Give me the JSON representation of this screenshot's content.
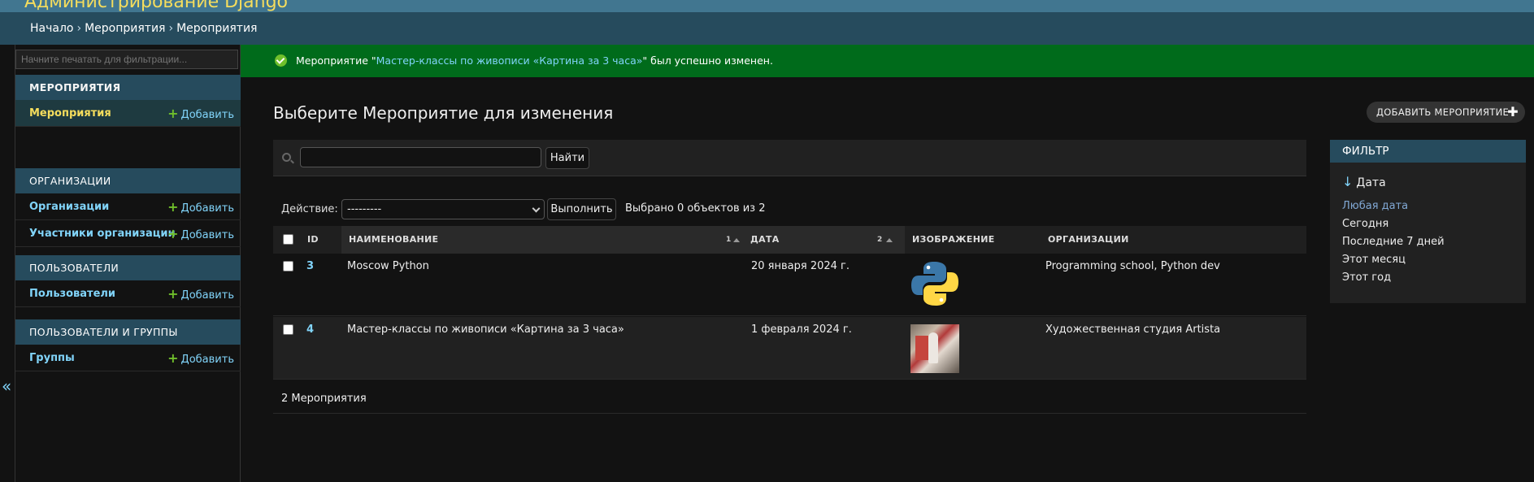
{
  "header": {
    "site_title": "Администрирование Django"
  },
  "breadcrumbs": {
    "home": "Начало",
    "sep": "›",
    "app": "Мероприятия",
    "current": "Мероприятия"
  },
  "nav": {
    "filter_placeholder": "Начните печатать для фильтрации...",
    "toggle": "«",
    "modules": [
      {
        "caption": "МЕРОПРИЯТИЯ",
        "models": [
          {
            "label": "Мероприятия",
            "add": "Добавить"
          }
        ]
      },
      {
        "caption": "ОРГАНИЗАЦИИ",
        "models": [
          {
            "label": "Организации",
            "add": "Добавить"
          },
          {
            "label": "Участники организации",
            "add": "Добавить"
          }
        ]
      },
      {
        "caption": "ПОЛЬЗОВАТЕЛИ",
        "models": [
          {
            "label": "Пользователи",
            "add": "Добавить"
          }
        ]
      },
      {
        "caption": "ПОЛЬЗОВАТЕЛИ И ГРУППЫ",
        "models": [
          {
            "label": "Группы",
            "add": "Добавить"
          }
        ]
      }
    ],
    "plus": "+"
  },
  "message": {
    "prefix": "Мероприятие \"",
    "link": "Мастер-классы по живописи «Картина за 3 часа»",
    "suffix": "\" был успешно изменен."
  },
  "page": {
    "title": "Выберите Мероприятие для изменения",
    "add_button": "ДОБАВИТЬ МЕРОПРИЯТИЕ",
    "add_plus": "✚"
  },
  "search": {
    "value": "",
    "button": "Найти"
  },
  "actions": {
    "label": "Действие:",
    "selected": "---------",
    "go": "Выполнить",
    "counter": "Выбрано 0 объектов из 2"
  },
  "table": {
    "headers": {
      "id": "ID",
      "name": "НАИМЕНОВАНИЕ",
      "date": "ДАТА",
      "image": "ИЗОБРАЖЕНИЕ",
      "orgs": "ОРГАНИЗАЦИИ"
    },
    "sort_priority": {
      "name": "1",
      "date": "2"
    },
    "rows": [
      {
        "id": "3",
        "name": "Moscow Python",
        "date": "20 января 2024 г.",
        "image": "python-logo",
        "orgs": "Programming school, Python dev"
      },
      {
        "id": "4",
        "name": "Мастер-классы по живописи «Картина за 3 часа»",
        "date": "1 февраля 2024 г.",
        "image": "painting-photo",
        "orgs": "Художественная студия Artista"
      }
    ],
    "footer": "2 Мероприятия"
  },
  "filter": {
    "title": "ФИЛЬТР",
    "heading": "Дата",
    "heading_arrow": "↓",
    "options": [
      "Любая дата",
      "Сегодня",
      "Последние 7 дней",
      "Этот месяц",
      "Этот год"
    ],
    "selected_index": 0
  },
  "colors": {
    "header": "#417690",
    "breadcrumbs": "#264b5d",
    "success": "#006b1b",
    "link": "#81d4fa",
    "add_plus": "#70bf2b"
  }
}
